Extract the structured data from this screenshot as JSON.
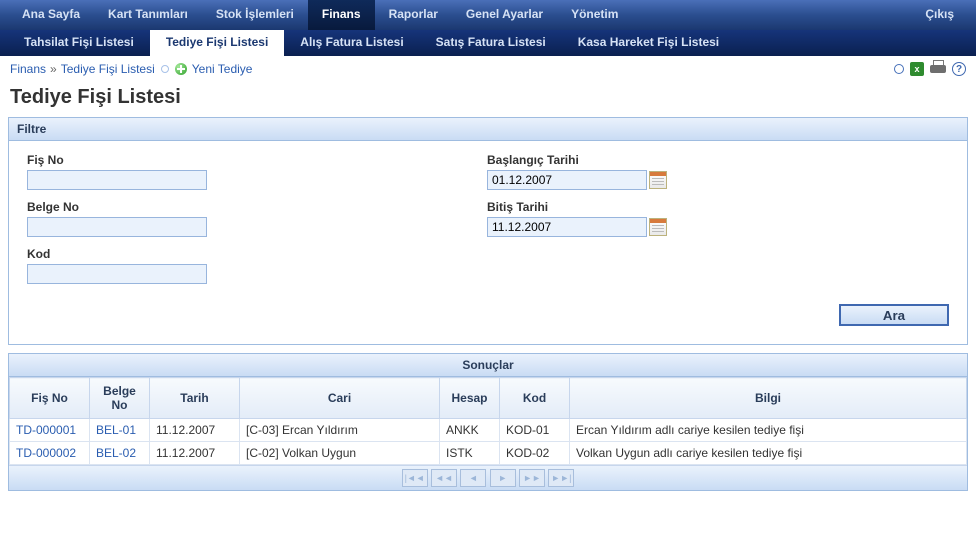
{
  "mainNav": {
    "items": [
      "Ana Sayfa",
      "Kart Tanımları",
      "Stok İşlemleri",
      "Finans",
      "Raporlar",
      "Genel Ayarlar",
      "Yönetim"
    ],
    "activeIndex": 3,
    "exit": "Çıkış"
  },
  "subNav": {
    "items": [
      "Tahsilat Fişi Listesi",
      "Tediye Fişi Listesi",
      "Alış Fatura Listesi",
      "Satış Fatura Listesi",
      "Kasa Hareket Fişi Listesi"
    ],
    "activeIndex": 1
  },
  "breadcrumb": {
    "root": "Finans",
    "sep": "»",
    "page": "Tediye Fişi Listesi",
    "newLink": "Yeni Tediye"
  },
  "pageTitle": "Tediye Fişi Listesi",
  "filter": {
    "panelTitle": "Filtre",
    "fisNoLabel": "Fiş No",
    "fisNo": "",
    "belgeNoLabel": "Belge No",
    "belgeNo": "",
    "kodLabel": "Kod",
    "kod": "",
    "startLabel": "Başlangıç Tarihi",
    "startDate": "01.12.2007",
    "endLabel": "Bitiş Tarihi",
    "endDate": "11.12.2007",
    "searchLabel": "Ara"
  },
  "results": {
    "title": "Sonuçlar",
    "headers": {
      "fisNo": "Fiş No",
      "belgeNo": "Belge No",
      "tarih": "Tarih",
      "cari": "Cari",
      "hesap": "Hesap",
      "kod": "Kod",
      "bilgi": "Bilgi"
    },
    "rows": [
      {
        "fisNo": "TD-000001",
        "belgeNo": "BEL-01",
        "tarih": "11.12.2007",
        "cari": "[C-03] Ercan Yıldırım",
        "hesap": "ANKK",
        "kod": "KOD-01",
        "bilgi": "Ercan Yıldırım adlı cariye kesilen tediye fişi"
      },
      {
        "fisNo": "TD-000002",
        "belgeNo": "BEL-02",
        "tarih": "11.12.2007",
        "cari": "[C-02] Volkan Uygun",
        "hesap": "ISTK",
        "kod": "KOD-02",
        "bilgi": "Volkan Uygun adlı cariye kesilen tediye fişi"
      }
    ]
  },
  "pager": {
    "first": "|◄◄",
    "prev": "◄◄",
    "prevOne": "◄",
    "nextOne": "►",
    "next": "►►",
    "last": "►►|"
  }
}
